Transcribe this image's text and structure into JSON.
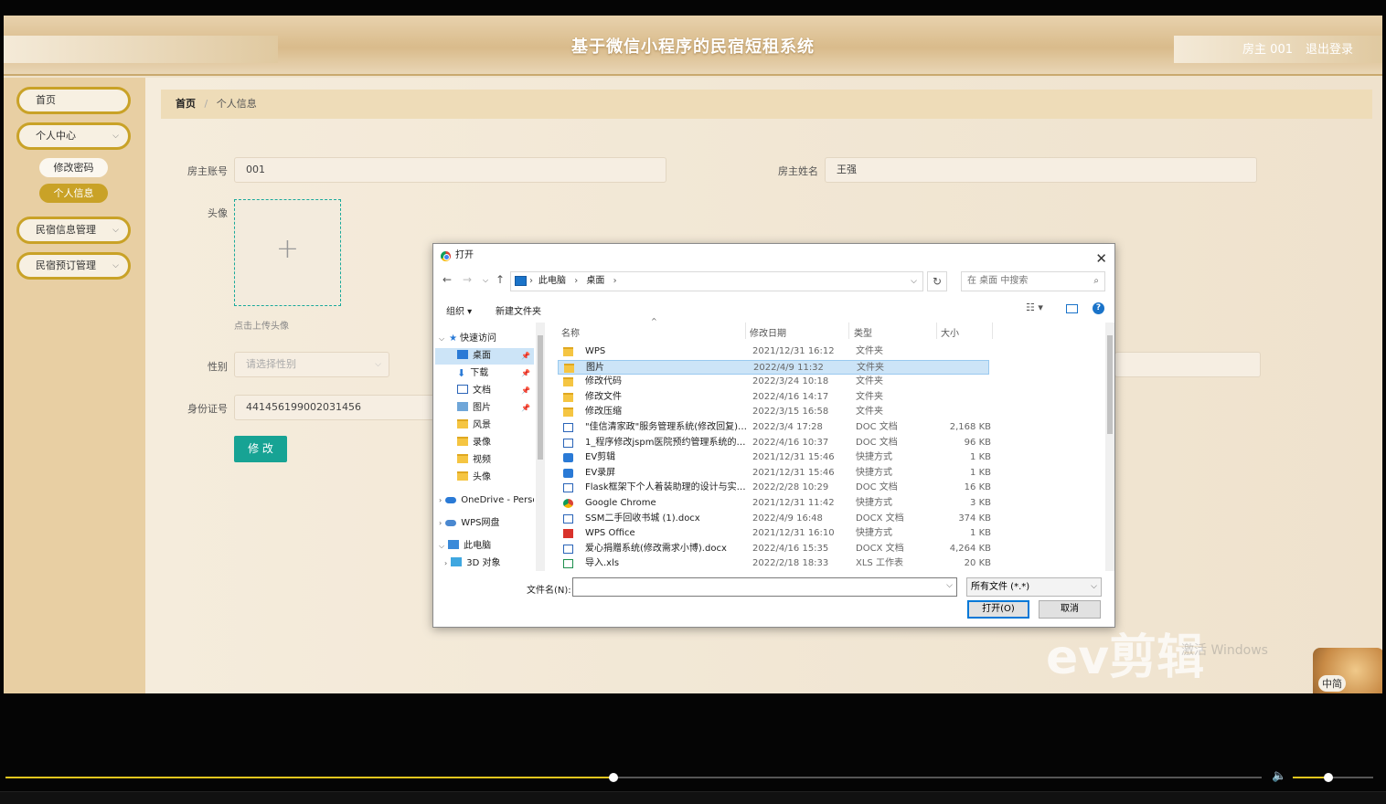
{
  "header": {
    "title": "基于微信小程序的民宿短租系统",
    "user": "房主 001",
    "logout": "退出登录"
  },
  "sidebar": {
    "items": [
      {
        "label": "首页"
      },
      {
        "label": "个人中心"
      },
      {
        "label": "民宿信息管理"
      },
      {
        "label": "民宿预订管理"
      }
    ],
    "sub": [
      {
        "label": "修改密码"
      },
      {
        "label": "个人信息"
      }
    ]
  },
  "breadcrumb": {
    "home": "首页",
    "sep": "/",
    "current": "个人信息"
  },
  "form": {
    "account_label": "房主账号",
    "account_value": "001",
    "name_label": "房主姓名",
    "name_value": "王强",
    "avatar_label": "头像",
    "upload_hint": "点击上传头像",
    "plus": "+",
    "gender_label": "性别",
    "gender_placeholder": "请选择性别",
    "id_label": "身份证号",
    "id_value": "441456199002031456",
    "edit_button": "修 改"
  },
  "dialog": {
    "title": "打开",
    "path": [
      "此电脑",
      "桌面"
    ],
    "search_placeholder": "在 桌面 中搜索",
    "toolbar": {
      "organize": "组织 ▾",
      "new_folder": "新建文件夹"
    },
    "nav": [
      {
        "label": "快速访问",
        "icon": "star-icon"
      },
      {
        "label": "桌面",
        "icon": "desktop-icon",
        "pinned": true,
        "selected": true
      },
      {
        "label": "下载",
        "icon": "download-icon",
        "pinned": true
      },
      {
        "label": "文档",
        "icon": "document-icon",
        "pinned": true
      },
      {
        "label": "图片",
        "icon": "picture-icon",
        "pinned": true
      },
      {
        "label": "风景",
        "icon": "folder-icon"
      },
      {
        "label": "录像",
        "icon": "folder-icon"
      },
      {
        "label": "视频",
        "icon": "folder-icon"
      },
      {
        "label": "头像",
        "icon": "folder-icon"
      },
      {
        "label": "OneDrive - Perso",
        "icon": "cloud-icon"
      },
      {
        "label": "WPS网盘",
        "icon": "cloud-icon"
      },
      {
        "label": "此电脑",
        "icon": "computer-icon"
      },
      {
        "label": "3D 对象",
        "icon": "3d-objects-icon"
      }
    ],
    "columns": {
      "name": "名称",
      "date": "修改日期",
      "type": "类型",
      "size": "大小"
    },
    "files": [
      {
        "name": "WPS",
        "date": "2021/12/31 16:12",
        "type": "文件夹",
        "size": "",
        "icon": "folder"
      },
      {
        "name": "图片",
        "date": "2022/4/9 11:32",
        "type": "文件夹",
        "size": "",
        "icon": "folder"
      },
      {
        "name": "修改代码",
        "date": "2022/3/24 10:18",
        "type": "文件夹",
        "size": "",
        "icon": "folder"
      },
      {
        "name": "修改文件",
        "date": "2022/4/16 14:17",
        "type": "文件夹",
        "size": "",
        "icon": "folder"
      },
      {
        "name": "修改压缩",
        "date": "2022/3/15 16:58",
        "type": "文件夹",
        "size": "",
        "icon": "folder"
      },
      {
        "name": "\"佳信清家政\"服务管理系统(修改回复) (1)...",
        "date": "2022/3/4 17:28",
        "type": "DOC 文档",
        "size": "2,168 KB",
        "icon": "doc"
      },
      {
        "name": "1_程序修改jspm医院预约管理系统的设...",
        "date": "2022/4/16 10:37",
        "type": "DOC 文档",
        "size": "96 KB",
        "icon": "doc"
      },
      {
        "name": "EV剪辑",
        "date": "2021/12/31 15:46",
        "type": "快捷方式",
        "size": "1 KB",
        "icon": "lnk"
      },
      {
        "name": "EV录屏",
        "date": "2021/12/31 15:46",
        "type": "快捷方式",
        "size": "1 KB",
        "icon": "lnk"
      },
      {
        "name": "Flask框架下个人着装助理的设计与实现(...",
        "date": "2022/2/28 10:29",
        "type": "DOC 文档",
        "size": "16 KB",
        "icon": "doc"
      },
      {
        "name": "Google Chrome",
        "date": "2021/12/31 11:42",
        "type": "快捷方式",
        "size": "3 KB",
        "icon": "gch"
      },
      {
        "name": "SSM二手回收书城 (1).docx",
        "date": "2022/4/9 16:48",
        "type": "DOCX 文档",
        "size": "374 KB",
        "icon": "doc"
      },
      {
        "name": "WPS Office",
        "date": "2021/12/31 16:10",
        "type": "快捷方式",
        "size": "1 KB",
        "icon": "wps"
      },
      {
        "name": "爱心捐赠系统(修改需求小博).docx",
        "date": "2022/4/16 15:35",
        "type": "DOCX 文档",
        "size": "4,264 KB",
        "icon": "doc"
      },
      {
        "name": "导入.xls",
        "date": "2022/2/18 18:33",
        "type": "XLS 工作表",
        "size": "20 KB",
        "icon": "xls"
      }
    ],
    "selected_index": 1,
    "filename_label": "文件名(N):",
    "filetype": "所有文件 (*.*)",
    "open_button": "打开(O)",
    "cancel_button": "取消"
  },
  "overlay": {
    "watermark": "ev剪辑",
    "activate": "激活 Windows",
    "ime": "中简"
  },
  "player": {
    "progress": 0.484,
    "volume": 0.44
  }
}
